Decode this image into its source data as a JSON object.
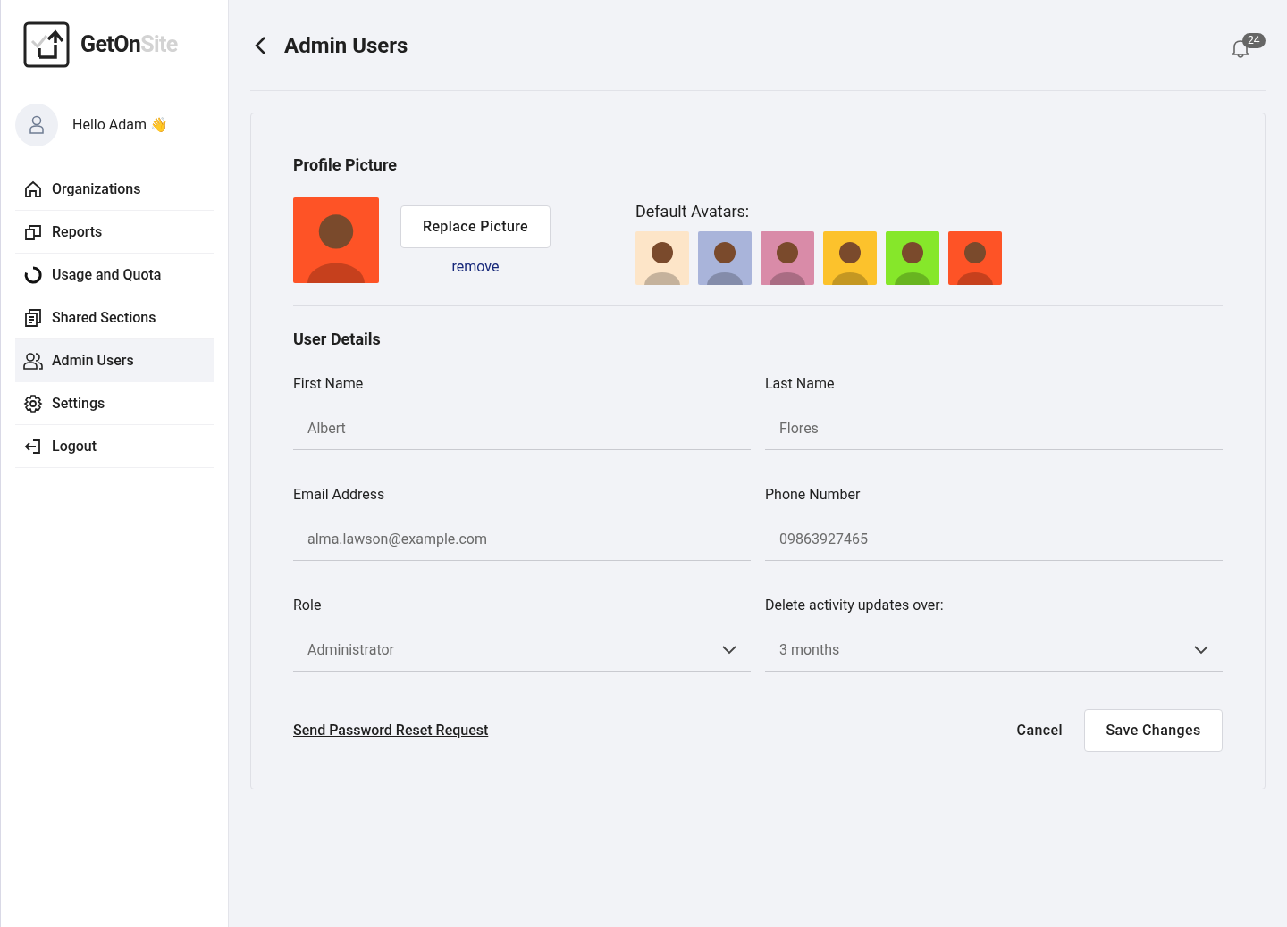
{
  "brand": {
    "primary": "GetOn",
    "secondary": "Site"
  },
  "greeting": {
    "text": "Hello Adam",
    "emoji": "👋"
  },
  "sidebar": {
    "items": [
      {
        "label": "Organizations",
        "selected": false
      },
      {
        "label": "Reports",
        "selected": false
      },
      {
        "label": "Usage and Quota",
        "selected": false
      },
      {
        "label": "Shared Sections",
        "selected": false
      },
      {
        "label": "Admin Users",
        "selected": true
      },
      {
        "label": "Settings",
        "selected": false
      },
      {
        "label": "Logout",
        "selected": false
      }
    ]
  },
  "header": {
    "title": "Admin Users",
    "notifications": "24"
  },
  "profile_picture": {
    "heading": "Profile Picture",
    "replace_button": "Replace Picture",
    "remove_link": "remove",
    "avatars_label": "Default Avatars:",
    "avatars": [
      {
        "color": "#fde5c8"
      },
      {
        "color": "#a9b4da"
      },
      {
        "color": "#d98ba8"
      },
      {
        "color": "#fcc22c"
      },
      {
        "color": "#86e72a"
      },
      {
        "color": "#fe5326"
      }
    ]
  },
  "user_details": {
    "heading": "User Details",
    "fields": [
      {
        "kind": "text",
        "label": "First Name",
        "value": "Albert"
      },
      {
        "kind": "text",
        "label": "Last Name",
        "value": "Flores"
      },
      {
        "kind": "text",
        "label": "Email Address",
        "value": "alma.lawson@example.com"
      },
      {
        "kind": "text",
        "label": "Phone Number",
        "value": "09863927465"
      },
      {
        "kind": "select",
        "label": "Role",
        "value": "Administrator"
      },
      {
        "kind": "select",
        "label": "Delete activity updates over:",
        "value": "3 months"
      }
    ]
  },
  "actions": {
    "reset_link": "Send Password Reset Request",
    "cancel": "Cancel",
    "save": "Save Changes"
  }
}
